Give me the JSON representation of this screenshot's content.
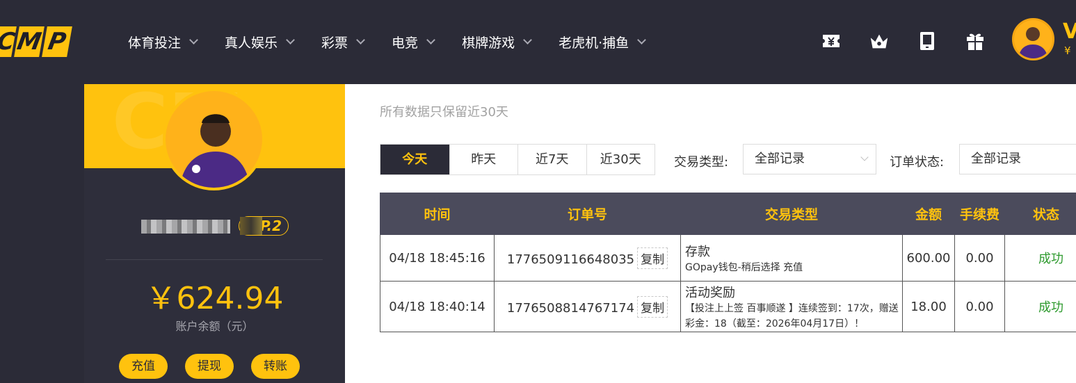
{
  "logo": {
    "letters": [
      "C",
      "M",
      "P"
    ]
  },
  "nav": {
    "items": [
      {
        "label": "体育投注"
      },
      {
        "label": "真人娱乐"
      },
      {
        "label": "彩票"
      },
      {
        "label": "电竞"
      },
      {
        "label": "棋牌游戏"
      },
      {
        "label": "老虎机·捕鱼"
      }
    ]
  },
  "top_icons": [
    "yen-ticket-icon",
    "crown-icon",
    "tablet-icon",
    "gift-icon"
  ],
  "user_header": {
    "vip_prefix": "V",
    "currency": "¥"
  },
  "profile": {
    "username": "",
    "vip_level": "P.2",
    "balance": "￥624.94",
    "balance_label": "账户余额（元）",
    "actions": [
      "充值",
      "提现",
      "转账"
    ]
  },
  "page": {
    "note": "所有数据只保留近30天",
    "ranges": [
      "今天",
      "昨天",
      "近7天",
      "近30天"
    ],
    "selected_range": "今天",
    "trade_type_label": "交易类型:",
    "trade_type_value": "全部记录",
    "order_status_label": "订单状态:",
    "order_status_value": "全部记录"
  },
  "table": {
    "headers": [
      "时间",
      "订单号",
      "交易类型",
      "金额",
      "手续费",
      "状态"
    ],
    "copy_label": "复制",
    "rows": [
      {
        "time": "04/18 18:45:16",
        "order_no": "1776509116648035",
        "type_title": "存款",
        "type_detail": "GOpay钱包-稍后选择 充值",
        "amount": "600.00",
        "fee": "0.00",
        "status": "成功"
      },
      {
        "time": "04/18 18:40:14",
        "order_no": "1776508814767174",
        "type_title": "活动奖励",
        "type_detail": "【投注上上签 百事顺遂 】连续签到：17次，赠送彩金：18（截至：2026年04月17日）！",
        "amount": "18.00",
        "fee": "0.00",
        "status": "成功"
      }
    ]
  },
  "colors": {
    "accent": "#ffc20e",
    "nav_bg": "#2b2b37",
    "success": "#2e9a2e"
  }
}
